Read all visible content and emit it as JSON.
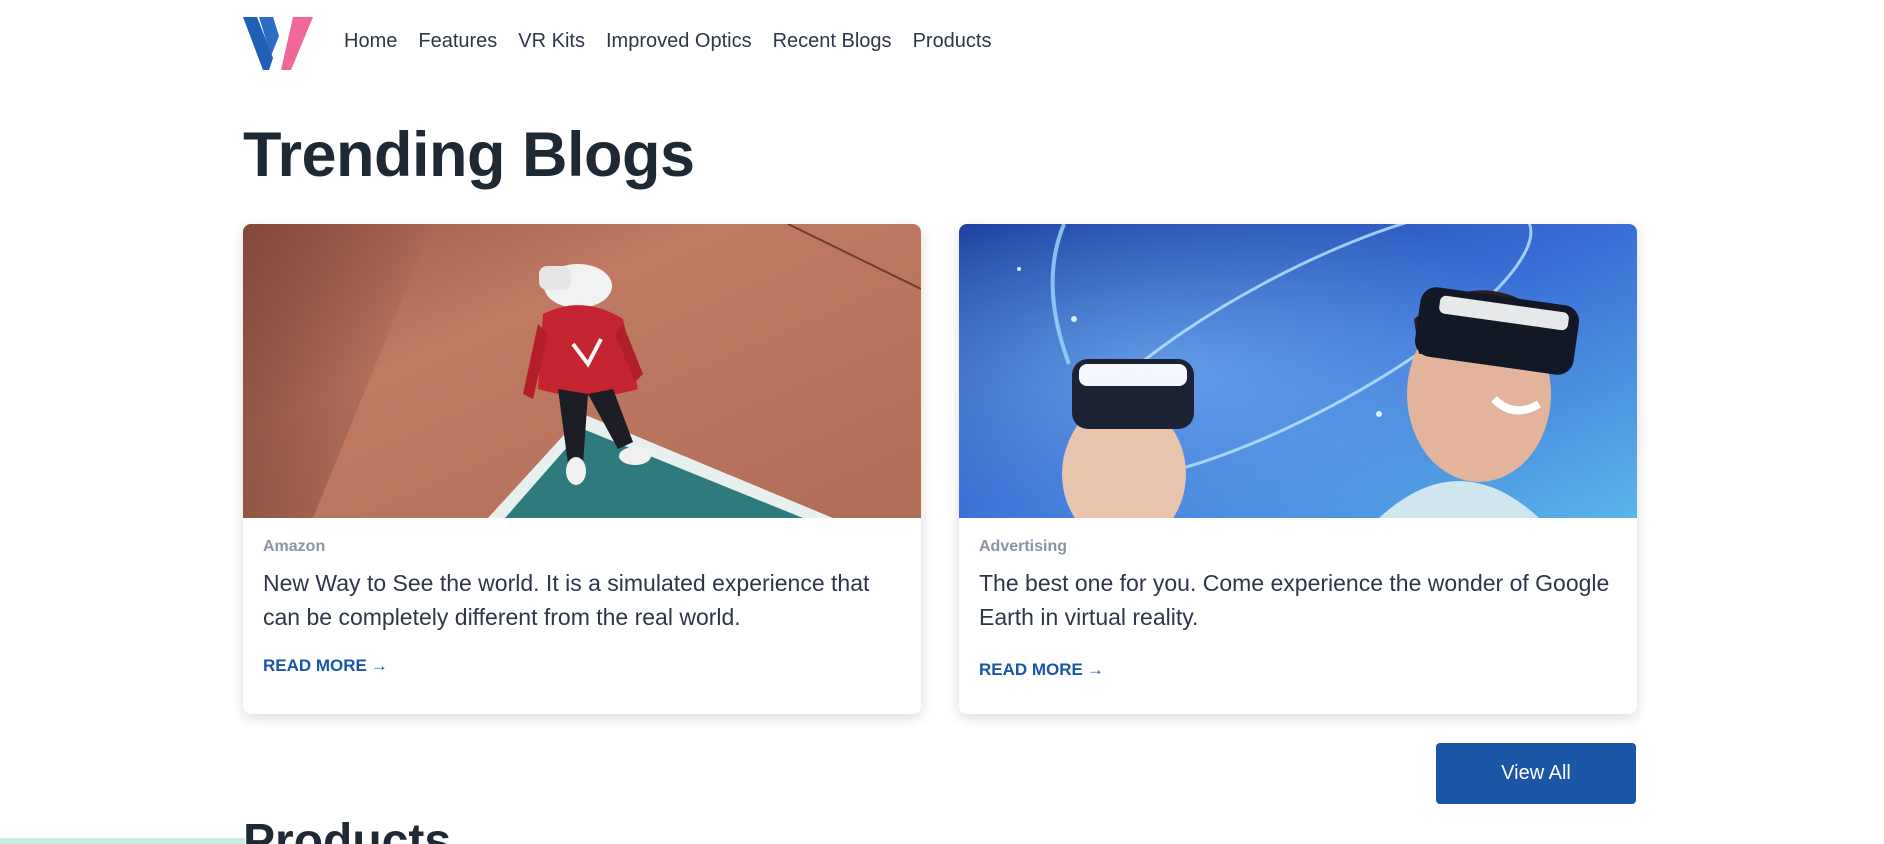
{
  "nav": {
    "logo": "V logo",
    "items": [
      {
        "label": "Home"
      },
      {
        "label": "Features"
      },
      {
        "label": "VR Kits"
      },
      {
        "label": "Improved Optics"
      },
      {
        "label": "Recent Blogs"
      },
      {
        "label": "Products"
      }
    ]
  },
  "main": {
    "title": "Trending Blogs",
    "cards": [
      {
        "category": "Amazon",
        "text": "New Way to See the world. It is a simulated experience that can be completely different from the real world.",
        "link": "READ MORE",
        "image": "person in red hoodie wearing VR headset on court"
      },
      {
        "category": "Advertising",
        "text": "The best one for you. Come experience the wonder of Google Earth in virtual reality.",
        "link": "READ MORE",
        "image": "two people wearing VR headsets with blue light rings"
      }
    ],
    "view_all": "View All",
    "next_section_title": "Products"
  },
  "colors": {
    "primary": "#1a56a5",
    "logo_blue": "#1f5fb5",
    "logo_pink": "#f0679a",
    "heading": "#1f2933",
    "muted": "#8a94a6"
  }
}
